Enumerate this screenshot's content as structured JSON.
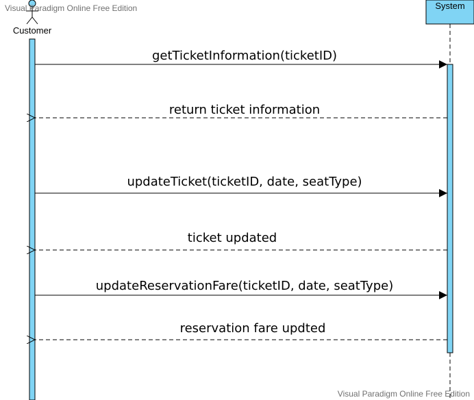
{
  "watermark": {
    "top": "Visual Paradigm Online Free Edition",
    "bottom": "Visual Paradigm Online Free Edition"
  },
  "colors": {
    "activation_fill": "#80d4f4",
    "lifeline_box_fill": "#80d4f4",
    "stroke": "#000000",
    "watermark": "#707070"
  },
  "actor": {
    "name": "Customer",
    "icon": "actor-stick-figure-icon"
  },
  "system": {
    "name": "System"
  },
  "messages": [
    {
      "label": "getTicketInformation(ticketID)",
      "kind": "call",
      "direction": "customer-to-system"
    },
    {
      "label": "return ticket information",
      "kind": "return",
      "direction": "system-to-customer"
    },
    {
      "label": "updateTicket(ticketID, date, seatType)",
      "kind": "call",
      "direction": "customer-to-system"
    },
    {
      "label": "ticket updated",
      "kind": "return",
      "direction": "system-to-customer"
    },
    {
      "label": "updateReservationFare(ticketID, date, seatType)",
      "kind": "call",
      "direction": "customer-to-system"
    },
    {
      "label": "reservation fare updted",
      "kind": "return",
      "direction": "system-to-customer"
    }
  ]
}
